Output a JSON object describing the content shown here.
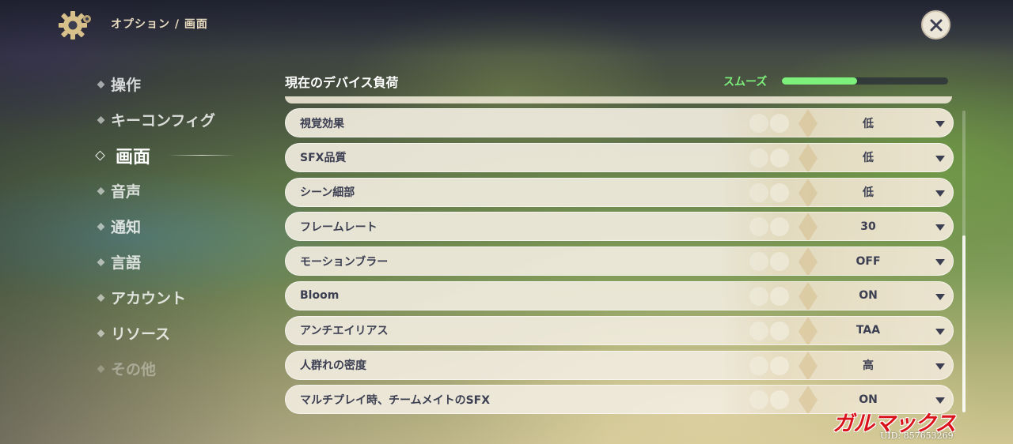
{
  "header": {
    "breadcrumb": "オプション / 画面"
  },
  "sidebar": {
    "items": [
      {
        "label": "操作"
      },
      {
        "label": "キーコンフィグ"
      },
      {
        "label": "画面",
        "active": true
      },
      {
        "label": "音声"
      },
      {
        "label": "通知"
      },
      {
        "label": "言語"
      },
      {
        "label": "アカウント"
      },
      {
        "label": "リソース"
      },
      {
        "label": "その他"
      }
    ]
  },
  "device_load": {
    "title": "現在のデバイス負荷",
    "status": "スムーズ",
    "level_fraction": 0.45,
    "status_color": "#7cf07a"
  },
  "settings": [
    {
      "label": "視覚効果",
      "value": "低"
    },
    {
      "label": "SFX品質",
      "value": "低"
    },
    {
      "label": "シーン細部",
      "value": "低"
    },
    {
      "label": "フレームレート",
      "value": "30"
    },
    {
      "label": "モーションブラー",
      "value": "OFF"
    },
    {
      "label": "Bloom",
      "value": "ON"
    },
    {
      "label": "アンチエイリアス",
      "value": "TAA"
    },
    {
      "label": "人群れの密度",
      "value": "高"
    },
    {
      "label": "マルチプレイ時、チームメイトのSFX",
      "value": "ON"
    }
  ],
  "watermark": {
    "logo_text": "ガルマックス",
    "uid": "UID: 857653269"
  },
  "icons": {
    "settings": "gear-icon",
    "close": "close-icon",
    "dropdown": "chevron-down-icon"
  }
}
